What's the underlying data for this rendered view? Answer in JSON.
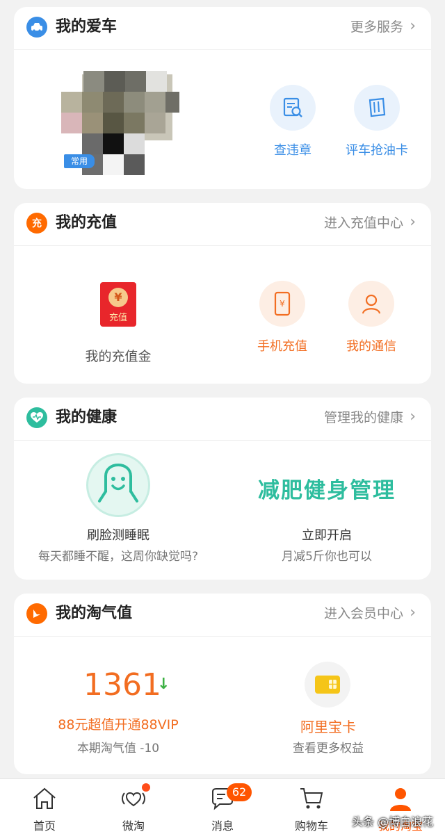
{
  "car": {
    "title": "我的爱车",
    "more": "更多服务",
    "tag": "常用",
    "actions": [
      "查违章",
      "评车抢油卡"
    ]
  },
  "recharge": {
    "title": "我的充值",
    "more": "进入充值中心",
    "badge_icon_text": "充",
    "envelope_text": "充值",
    "envelope_symbol": "¥",
    "gold_label": "我的充值金",
    "actions": [
      "手机充值",
      "我的通信"
    ]
  },
  "health": {
    "title": "我的健康",
    "more": "管理我的健康",
    "left_title": "刷脸测睡眠",
    "left_sub": "每天都睡不醒，这周你缺觉吗?",
    "right_headline": "减肥健身管理",
    "right_title": "立即开启",
    "right_sub": "月减5斤你也可以"
  },
  "taoqi": {
    "title": "我的淘气值",
    "more": "进入会员中心",
    "score": "1361",
    "trend_arrow": "↓",
    "vip_text": "88元超值开通88VIP",
    "period_text": "本期淘气值 -10",
    "card_title": "阿里宝卡",
    "card_sub": "查看更多权益"
  },
  "nav": {
    "items": [
      "首页",
      "微淘",
      "消息",
      "购物车",
      "我的淘宝"
    ],
    "message_badge": "62"
  },
  "watermark": "头条 @博白浪花",
  "colors": {
    "orange": "#ff5500",
    "blue": "#3a8ee6",
    "green": "#2ebd9e"
  }
}
